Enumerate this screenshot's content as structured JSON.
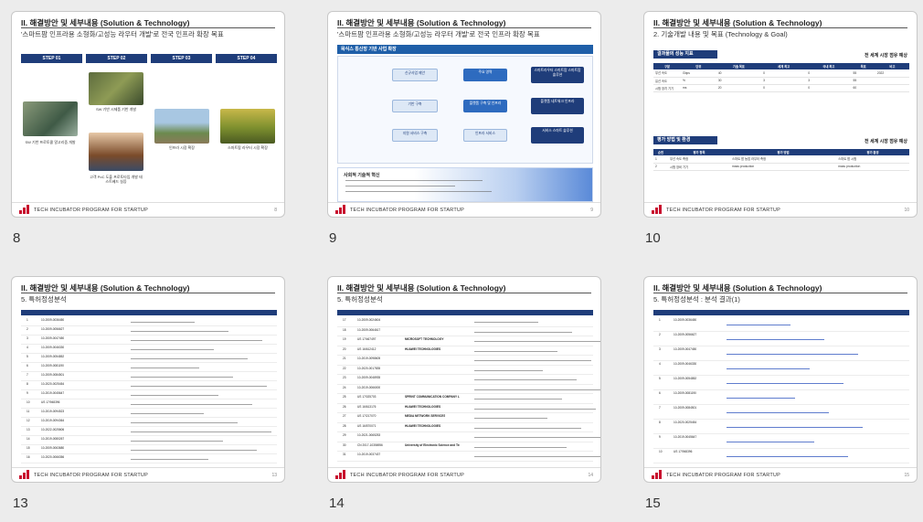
{
  "slides": [
    {
      "number": "8",
      "title": "II. 해결방안 및 세부내용 (Solution & Technology)",
      "subtitle": "'스마트팜 인프라용 소형화/고성능 라우터 개발'로 전국 인프라 확장 목표",
      "steps": [
        "STEP 01",
        "STEP 02",
        "STEP 03",
        "STEP 04"
      ],
      "captions": [
        "SW 기반\n프로토콜 알고리즘 개발",
        "SW 기반\n시제품 기반 개발",
        "인프라 시장 확장",
        "스마트팜\n라우터 시장 확장",
        "고객 PoC 도출\n프로토타입 개발 테스트베드 실증"
      ],
      "page": "8"
    },
    {
      "number": "9",
      "title": "II. 해결방안 및 세부내용 (Solution & Technology)",
      "subtitle": "'스마트팜 인프라용 소형화/고성능 라우터 개발'로 전국 인프라 확장 목표",
      "diagram_header": "목식스 통신망 기반 사업 확장",
      "boxes": [
        "신규사업 제안",
        "기반 구축",
        "지원 서비스 구축",
        "주요 영역",
        "플랫폼 구축 및 인프라",
        "인프라 서비스",
        "스마트라우터 스마트팜 스마트팜 솔루션",
        "플랫폼 네트워크 인프라",
        "서비스 스마트 솔루션"
      ],
      "section_text": "사회적 기술적 혁신",
      "page": "9"
    },
    {
      "number": "10",
      "title": "II. 해결방안 및 세부내용 (Solution & Technology)",
      "subtitle": "2. 기술개발 내용 및 목표 (Technology & Goal)",
      "section1": "결과물의 성능 지표",
      "section1_note": "전 세계 시장 점유 예상",
      "section2": "평가 방법 및 환경",
      "section2_note": "전 세계 시장 점유 예상",
      "table1_rows": [
        [
          "무선 속도",
          "Gbps",
          "40",
          "0",
          "0",
          "55",
          "2022"
        ],
        [
          "유선 속도",
          "%",
          "30",
          "3",
          "3",
          "55",
          ""
        ],
        [
          "시험 장치 기기",
          "ms",
          "20",
          "0",
          "0",
          "60",
          ""
        ]
      ],
      "table2_rows": [
        [
          "1",
          "무선 속도 측정",
          "스마트 팜 농업 라우터 측정",
          "스마트 팜 시험"
        ],
        [
          "2",
          "시험 장비 기기",
          "mass production",
          "mass production"
        ]
      ],
      "page": "10"
    },
    {
      "number": "13",
      "title": "II. 해결방안 및 세부내용 (Solution & Technology)",
      "subtitle": "5. 특허정성분석",
      "rows": [
        "10-2009-0036450",
        "10-2009-0056627",
        "10-2009-0047450",
        "10-2009-0046330",
        "10-2009-0054852",
        "10-2009-0081190",
        "10-2009-0084501",
        "10-2020-0025454",
        "10-2019-0045647",
        "US 17/948396",
        "10-2019-0094523",
        "10-2019-0094364",
        "10-2022-0025606",
        "10-2019-0080267",
        "10-2009-0063680",
        "10-2020-0066356"
      ],
      "page": "13"
    },
    {
      "number": "14",
      "title": "II. 해결방안 및 세부내용 (Solution & Technology)",
      "subtitle": "5. 특허정성분석",
      "rows": [
        "10-2009-0024604",
        "10-2009-0064617",
        "US 17/467497",
        "US 16/612412",
        "10-2019-0098605",
        "10-2020-0017835",
        "10-2009-0048935",
        "10-2019-0066000",
        "US 17/025703",
        "US 16/613176",
        "US 17/217070",
        "US 16/570071",
        "10-2021-0065253",
        "CN 2017-10356956",
        "10-2019-0037437"
      ],
      "companies": [
        "",
        "",
        "MICROSOFT TECHNOLOGY",
        "HUAWEI TECHNOLOGIES",
        "",
        "",
        "",
        "",
        "SPRINT COMMUNICATION COMPANY L.P.",
        "HUAWEI TECHNOLOGIES",
        "MEDIA NETWORK SERVICES",
        "HUAWEI TECHNOLOGIES",
        "",
        "University of Electronic Science and Technology of China",
        ""
      ],
      "page": "14"
    },
    {
      "number": "15",
      "title": "II. 해결방안 및 세부내용 (Solution & Technology)",
      "subtitle": "5. 특허정성분석 : 분석 결과(1)",
      "rows": [
        "10-2009-0036450",
        "10-2009-0056627",
        "10-2009-0047450",
        "10-2009-0046330",
        "10-2009-0054852",
        "10-2009-0081190",
        "10-2009-0084501",
        "10-2020-0025454",
        "10-2019-0045647",
        "US 17/948396"
      ],
      "page": "15"
    }
  ],
  "footer_text": "TECH INCUBATOR PROGRAM FOR STARTUP"
}
